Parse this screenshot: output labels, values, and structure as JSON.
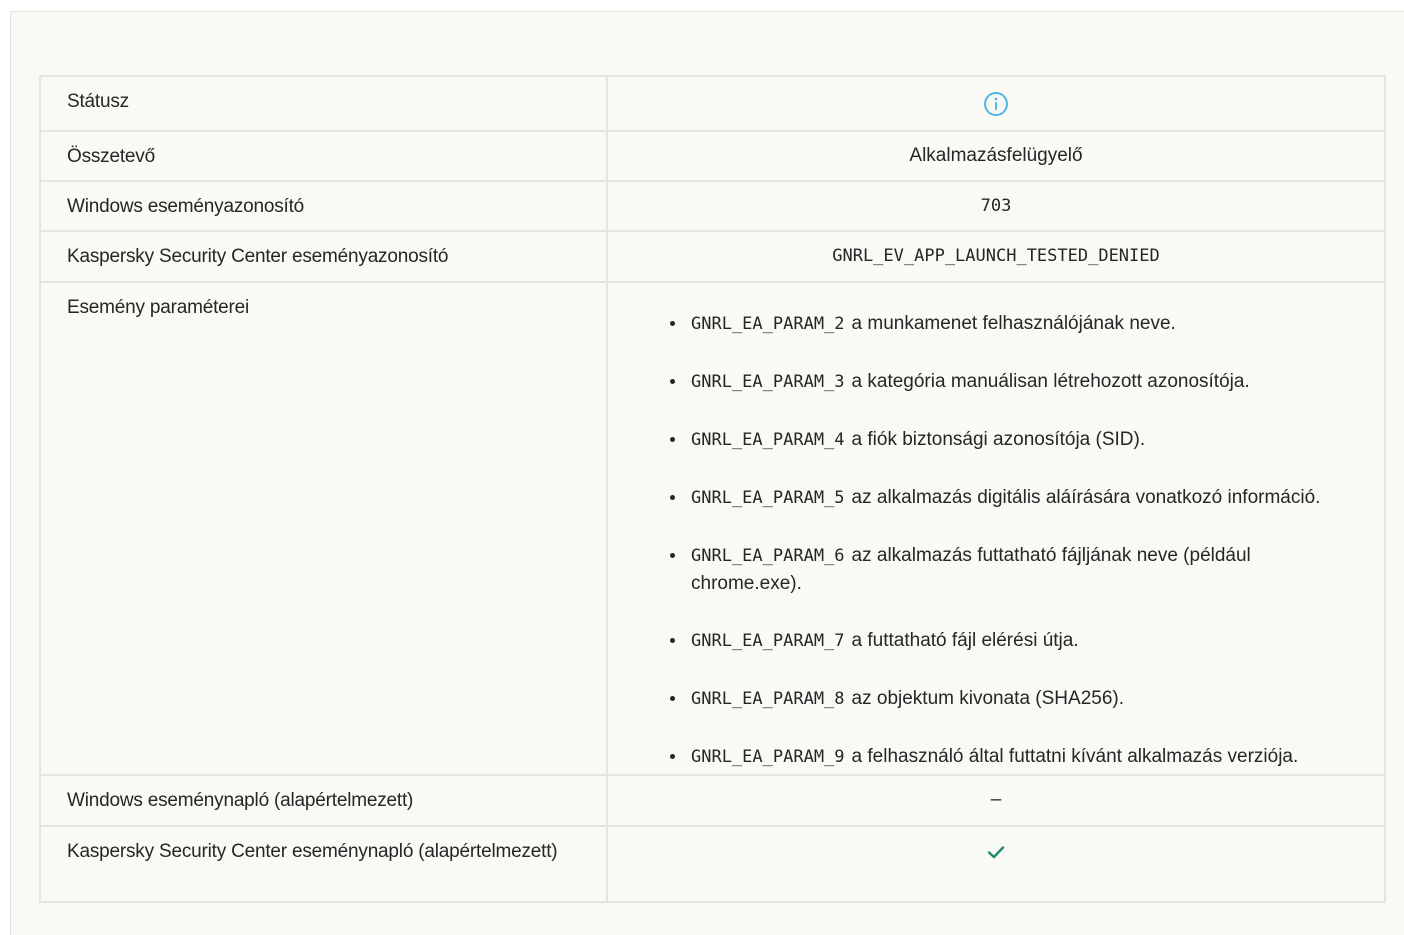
{
  "rows": {
    "status": {
      "label": "Státusz",
      "icon": "info-icon",
      "icon_color": "#4fb8e3"
    },
    "component": {
      "label": "Összetevő",
      "value": "Alkalmazásfelügyelő"
    },
    "windows_event_id": {
      "label": "Windows eseményazonosító",
      "value": "703"
    },
    "ksc_event_id": {
      "label": "Kaspersky Security Center eseményazonosító",
      "value": "GNRL_EV_APP_LAUNCH_TESTED_DENIED"
    },
    "event_params": {
      "label": "Esemény paraméterei",
      "items": [
        {
          "code": "GNRL_EA_PARAM_2",
          "text": "a munkamenet felhasználójának neve."
        },
        {
          "code": "GNRL_EA_PARAM_3",
          "text": "a kategória manuálisan létrehozott azonosítója."
        },
        {
          "code": "GNRL_EA_PARAM_4",
          "text": "a fiók biztonsági azonosítója (SID)."
        },
        {
          "code": "GNRL_EA_PARAM_5",
          "text": "az alkalmazás digitális aláírására vonatkozó információ."
        },
        {
          "code": "GNRL_EA_PARAM_6",
          "text": "az alkalmazás futtatható fájljának neve (például chrome.exe)."
        },
        {
          "code": "GNRL_EA_PARAM_7",
          "text": "a futtatható fájl elérési útja."
        },
        {
          "code": "GNRL_EA_PARAM_8",
          "text": "az objektum kivonata (SHA256)."
        },
        {
          "code": "GNRL_EA_PARAM_9",
          "text": "a felhasználó által futtatni kívánt alkalmazás verziója."
        }
      ]
    },
    "windows_log": {
      "label": "Windows eseménynapló (alapértelmezett)",
      "value": "–"
    },
    "ksc_log": {
      "label": "Kaspersky Security Center eseménynapló (alapértelmezett)",
      "icon": "check-icon",
      "icon_color": "#1f8a70"
    }
  }
}
